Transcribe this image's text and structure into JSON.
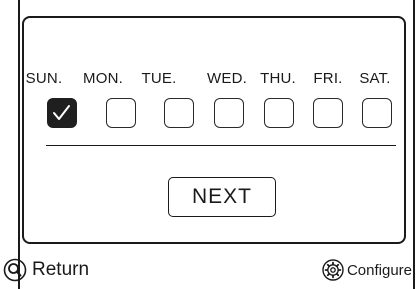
{
  "schedule": {
    "days": [
      {
        "label": "SUN.",
        "checked": true
      },
      {
        "label": "MON.",
        "checked": false
      },
      {
        "label": "TUE.",
        "checked": false
      },
      {
        "label": "WED.",
        "checked": false
      },
      {
        "label": "THU.",
        "checked": false
      },
      {
        "label": "FRI.",
        "checked": false
      },
      {
        "label": "SAT.",
        "checked": false
      }
    ],
    "next_label": "NEXT"
  },
  "footer": {
    "return_label": "Return",
    "return_icon": "search-icon",
    "configure_label": "Configure",
    "configure_icon": "gear-icon"
  },
  "colors": {
    "foreground": "#1a1a1a",
    "checked_fill": "#1f1f1f",
    "background": "#ffffff"
  }
}
